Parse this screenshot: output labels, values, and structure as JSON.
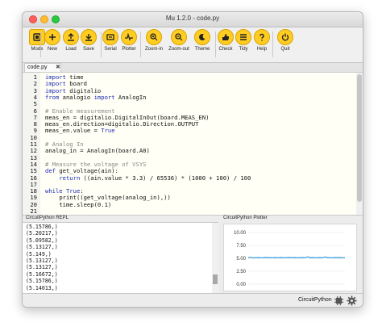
{
  "window": {
    "title": "Mu 1.2.0 - code.py"
  },
  "toolbar": {
    "buttons": [
      {
        "label": "Mode",
        "icon": "mode-icon"
      },
      {
        "label": "New",
        "icon": "plus-icon"
      },
      {
        "label": "Load",
        "icon": "upload-icon"
      },
      {
        "label": "Save",
        "icon": "download-icon"
      },
      {
        "label": "Serial",
        "icon": "serial-icon"
      },
      {
        "label": "Plotter",
        "icon": "pulse-icon"
      },
      {
        "label": "Zoom-in",
        "icon": "zoom-in-icon"
      },
      {
        "label": "Zoom-out",
        "icon": "zoom-out-icon"
      },
      {
        "label": "Theme",
        "icon": "moon-icon"
      },
      {
        "label": "Check",
        "icon": "thumbs-up-icon"
      },
      {
        "label": "Tidy",
        "icon": "lines-icon"
      },
      {
        "label": "Help",
        "icon": "question-icon"
      },
      {
        "label": "Quit",
        "icon": "power-icon"
      }
    ]
  },
  "tabs": [
    {
      "label": "code.py",
      "close": "✖"
    }
  ],
  "editor": {
    "lines": [
      {
        "n": "1",
        "text": "import time"
      },
      {
        "n": "2",
        "text": "import board"
      },
      {
        "n": "3",
        "text": "import digitalio"
      },
      {
        "n": "4",
        "text": "from analogio import AnalogIn"
      },
      {
        "n": "5",
        "text": ""
      },
      {
        "n": "6",
        "text": "# Enable measurement"
      },
      {
        "n": "7",
        "text": "meas_en = digitalio.DigitalInOut(board.MEAS_EN)"
      },
      {
        "n": "8",
        "text": "meas_en.direction=digitalio.Direction.OUTPUT"
      },
      {
        "n": "9",
        "text": "meas_en.value = True"
      },
      {
        "n": "10",
        "text": ""
      },
      {
        "n": "11",
        "text": "# Analog In"
      },
      {
        "n": "12",
        "text": "analog_in = AnalogIn(board.A0)"
      },
      {
        "n": "13",
        "text": ""
      },
      {
        "n": "14",
        "text": "# Measure the voltage of VSYS"
      },
      {
        "n": "15",
        "text": "def get_voltage(ain):"
      },
      {
        "n": "16",
        "text": "    return ((ain.value * 3.3) / 65536) * (1000 + 100) / 100"
      },
      {
        "n": "17",
        "text": ""
      },
      {
        "n": "18",
        "text": "while True:"
      },
      {
        "n": "19",
        "text": "    print((get_voltage(analog_in),))"
      },
      {
        "n": "20",
        "text": "    time.sleep(0.1)"
      },
      {
        "n": "21",
        "text": ""
      }
    ]
  },
  "repl": {
    "title": "CircuitPython REPL",
    "lines": [
      "(5.15786,)",
      "(5.20217,)",
      "(5.09582,)",
      "(5.13127,)",
      "(5.149,)",
      "(5.13127,)",
      "(5.13127,)",
      "(5.16672,)",
      "(5.15786,)",
      "(5.14013,)"
    ]
  },
  "plotter": {
    "title": "CircuitPython Plotter",
    "chart_data": {
      "type": "line",
      "yticks": [
        "10.00",
        "7.50",
        "5.00",
        "2.50",
        "0.00"
      ],
      "ylim": [
        0,
        10
      ],
      "grid": true,
      "series": [
        {
          "values": [
            5.16,
            5.2,
            5.1,
            5.13,
            5.15,
            5.13,
            5.13,
            5.17,
            5.16,
            5.14,
            5.13,
            5.15,
            5.12,
            5.16,
            5.14,
            5.13,
            5.17,
            5.15,
            5.14,
            5.16,
            5.13,
            5.14,
            5.15,
            5.13,
            5.3,
            5.14,
            5.15,
            5.13,
            5.14,
            5.16,
            5.13,
            5.28,
            5.15,
            5.14,
            5.13,
            5.16,
            5.14,
            5.15,
            5.13,
            5.14
          ],
          "color": "#2f9be0"
        }
      ]
    }
  },
  "status": {
    "mode": "CircuitPython",
    "icons": [
      "chip-icon",
      "gear-icon"
    ]
  },
  "colors": {
    "accent": "#ffcc22",
    "keyword": "#1f2bb5",
    "comment": "#8a8a8a",
    "line": "#2f9be0"
  }
}
